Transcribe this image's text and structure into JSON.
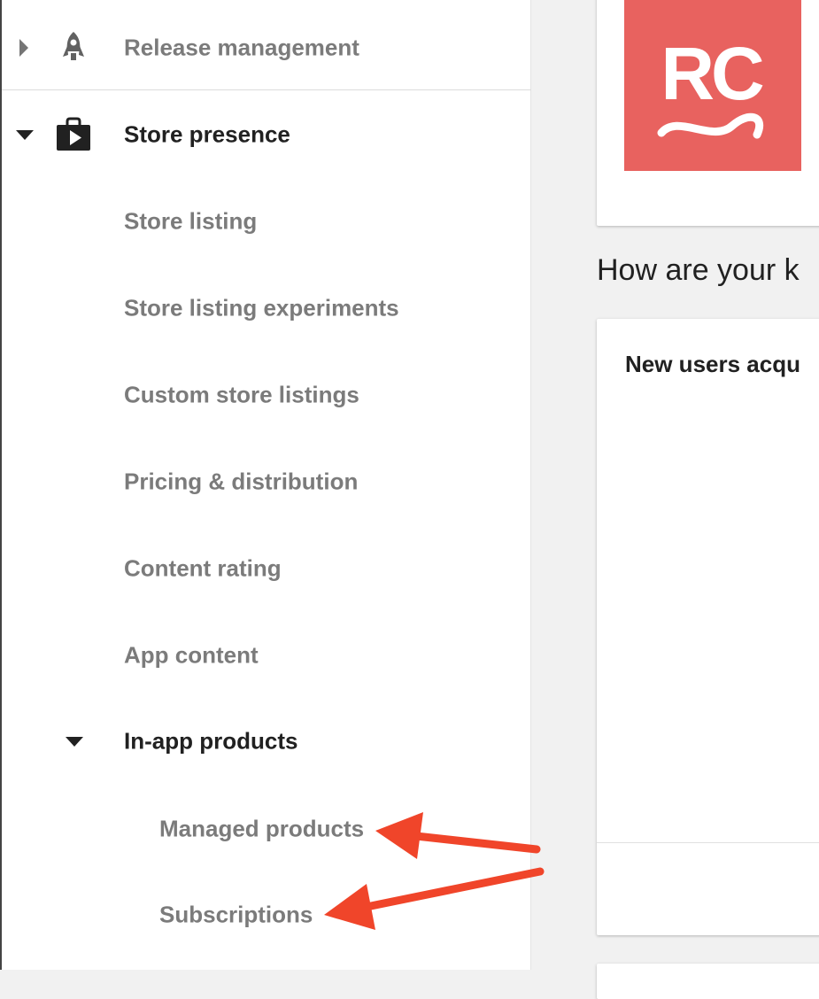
{
  "sidebar": {
    "items": [
      {
        "label": "Release management",
        "icon": "rocket-icon",
        "expander": "chevron-right-icon"
      },
      {
        "label": "Store presence",
        "icon": "play-store-bag-icon",
        "expander": "chevron-down-icon",
        "active": true
      },
      {
        "label": "Store listing"
      },
      {
        "label": "Store listing experiments"
      },
      {
        "label": "Custom store listings"
      },
      {
        "label": "Pricing & distribution"
      },
      {
        "label": "Content rating"
      },
      {
        "label": "App content"
      },
      {
        "label": "In-app products",
        "expander": "chevron-down-icon",
        "active": true
      },
      {
        "label": "Managed products"
      },
      {
        "label": "Subscriptions"
      }
    ]
  },
  "main": {
    "heading": "How are your k",
    "card_title": "New users acqu",
    "logo": {
      "text": "RC",
      "color": "#e8625f"
    }
  },
  "annotations": {
    "arrow_color": "#f0452a"
  },
  "colors": {
    "sidebar_bg": "#ffffff",
    "page_bg": "#f1f1f1",
    "text_muted": "#7b7b7b",
    "text_dark": "#212121"
  }
}
